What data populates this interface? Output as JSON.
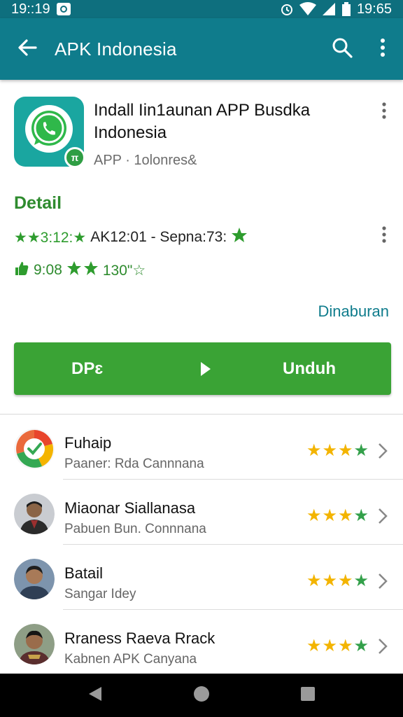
{
  "status_bar": {
    "time_left": "19::19",
    "time_right": "19:65"
  },
  "app_bar": {
    "title": "APK Indonesia",
    "icons": [
      "back-arrow-icon",
      "search-icon",
      "more-vert-icon"
    ]
  },
  "app": {
    "name": "Indall Iin1aunan APP Busdka Indonesia",
    "subtitle": "APP · 1olonres&"
  },
  "detail": {
    "heading": "Detail",
    "row1_prefix": "★★3:12:★",
    "row1_text": "AK12:01 - Sepna:73:",
    "row2_text": "9:08",
    "row2_suffix": "130\"☆",
    "more_link": "Dinaburan"
  },
  "download": {
    "left_label": "DPɛ",
    "right_label": "Unduh"
  },
  "list": [
    {
      "title": "Fuhaip",
      "subtitle": "Paaner: Rda  Cannnana",
      "yellow_stars": 3,
      "green_stars": 1
    },
    {
      "title": "Miaonar Siallanasa",
      "subtitle": "Pabuen Bun. Connnana",
      "yellow_stars": 3,
      "green_stars": 1
    },
    {
      "title": "Batail",
      "subtitle": "Sangar Idey",
      "yellow_stars": 3,
      "green_stars": 1
    },
    {
      "title": "Rraness Raeva Rrack",
      "subtitle": "Kabnen APK Canyana",
      "yellow_stars": 3,
      "green_stars": 1
    }
  ],
  "colors": {
    "status_bar": "#0e6f7e",
    "app_bar": "#0f7c8c",
    "accent_green": "#3aa335",
    "star_yellow": "#f3b400",
    "star_green": "#33a04a"
  }
}
